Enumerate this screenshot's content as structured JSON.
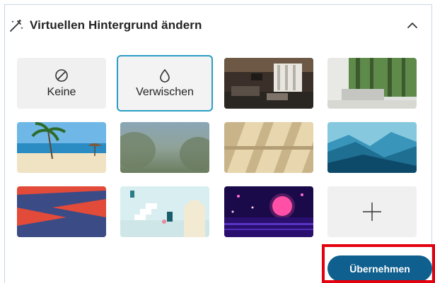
{
  "panel": {
    "title": "Virtuellen Hintergrund ändern",
    "title_icon": "magic-wand-icon",
    "collapse_icon": "chevron-up-icon"
  },
  "options": {
    "none": {
      "label": "Keine",
      "icon": "prohibited-icon"
    },
    "blur": {
      "label": "Verwischen",
      "icon": "drop-icon",
      "selected": true
    }
  },
  "backgrounds": [
    "modern-living-room",
    "room-with-forest-window",
    "tropical-beach",
    "blurred-landscape",
    "sunlit-wall-shadows",
    "teal-mountains",
    "red-blue-abstract",
    "pastel-stairs-scene",
    "purple-neon-planet"
  ],
  "add": {
    "icon": "plus-icon"
  },
  "actions": {
    "apply_label": "Übernehmen"
  },
  "colors": {
    "accent": "#0f5f8f",
    "selection": "#2a9dc5",
    "highlight": "#e3000f"
  }
}
